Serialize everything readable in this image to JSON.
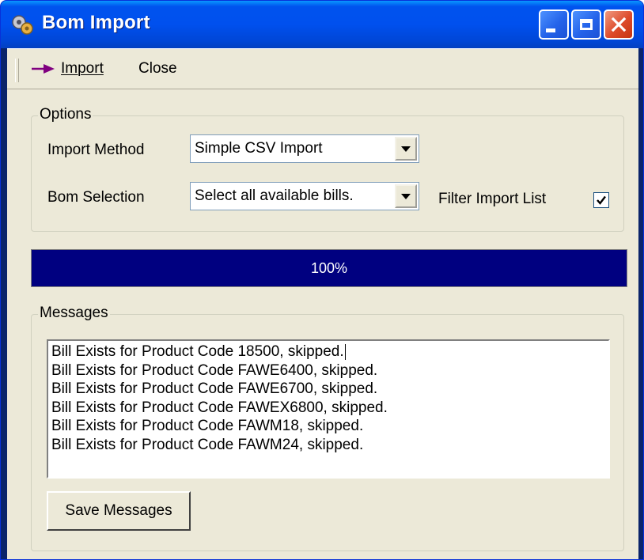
{
  "window": {
    "title": "Bom Import",
    "app_icon": "gears-icon",
    "controls": [
      "minimize-icon",
      "maximize-icon",
      "close-icon"
    ]
  },
  "toolbar": {
    "import_label": "Import",
    "import_icon": "arrow-right-icon",
    "close_label": "Close"
  },
  "options": {
    "group_label": "Options",
    "import_method_label": "Import Method",
    "import_method_value": "Simple CSV Import",
    "bom_selection_label": "Bom Selection",
    "bom_selection_value": "Select all available bills.",
    "filter_label": "Filter Import List",
    "filter_checked": true
  },
  "progress": {
    "percent": 100,
    "text": "100%"
  },
  "messages": {
    "group_label": "Messages",
    "lines": [
      "Bill Exists for Product Code 18500, skipped.",
      "Bill Exists for Product Code FAWE6400, skipped.",
      "Bill Exists for Product Code FAWE6700, skipped.",
      "Bill Exists for Product Code FAWEX6800, skipped.",
      "Bill Exists for Product Code FAWM18, skipped.",
      "Bill Exists for Product Code FAWM24, skipped."
    ],
    "save_button": "Save Messages"
  },
  "colors": {
    "titlebar": "#0054e3",
    "progress_fill": "#000080",
    "face": "#ece9d8",
    "close_button": "#dd4a2a"
  }
}
